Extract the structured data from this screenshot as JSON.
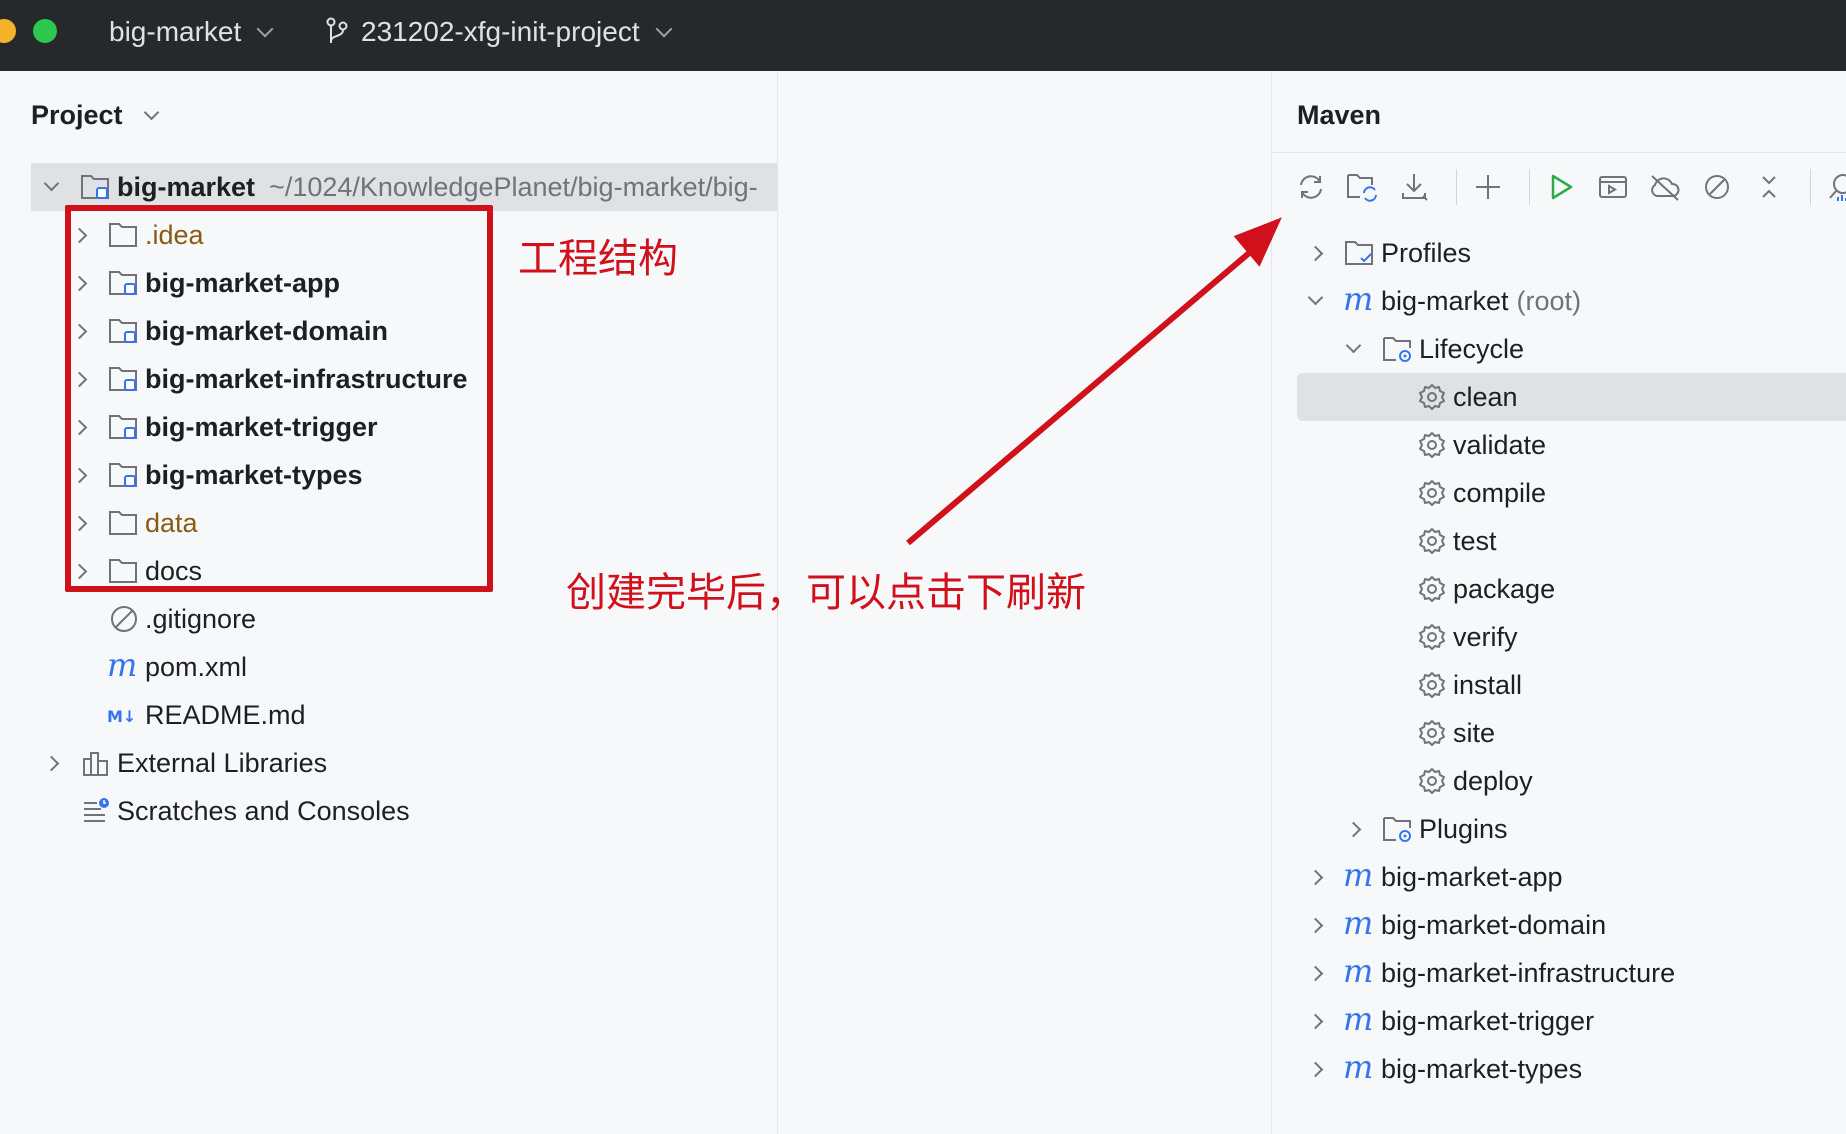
{
  "titlebar": {
    "project": "big-market",
    "branch": "231202-xfg-init-project"
  },
  "project_panel": {
    "title": "Project",
    "root": {
      "name": "big-market",
      "path": "~/1024/KnowledgePlanet/big-market/big-"
    },
    "items": [
      {
        "label": ".idea",
        "icon": "folder-icon",
        "style": "brown",
        "expandable": true
      },
      {
        "label": "big-market-app",
        "icon": "module-folder-icon",
        "style": "bold",
        "expandable": true
      },
      {
        "label": "big-market-domain",
        "icon": "module-folder-icon",
        "style": "bold",
        "expandable": true
      },
      {
        "label": "big-market-infrastructure",
        "icon": "module-folder-icon",
        "style": "bold",
        "expandable": true
      },
      {
        "label": "big-market-trigger",
        "icon": "module-folder-icon",
        "style": "bold",
        "expandable": true
      },
      {
        "label": "big-market-types",
        "icon": "module-folder-icon",
        "style": "bold",
        "expandable": true
      },
      {
        "label": "data",
        "icon": "folder-icon",
        "style": "brown",
        "expandable": true
      },
      {
        "label": "docs",
        "icon": "folder-icon",
        "style": "normal",
        "expandable": true
      },
      {
        "label": ".gitignore",
        "icon": "ignored-file-icon",
        "style": "normal",
        "expandable": false
      },
      {
        "label": "pom.xml",
        "icon": "maven-icon",
        "style": "normal",
        "expandable": false
      },
      {
        "label": "README.md",
        "icon": "markdown-icon",
        "style": "normal",
        "expandable": false
      }
    ],
    "external_libraries": "External Libraries",
    "scratches": "Scratches and Consoles"
  },
  "maven_panel": {
    "title": "Maven",
    "toolbar": [
      "reload-icon",
      "reload-project-icon",
      "download-icon",
      "add-icon",
      "run-icon",
      "execute-goal-icon",
      "offline-icon",
      "skip-tests-icon",
      "collapse-icon",
      "analyze-icon"
    ],
    "profiles": "Profiles",
    "root": {
      "name": "big-market",
      "suffix": "(root)"
    },
    "lifecycle": "Lifecycle",
    "goals": [
      "clean",
      "validate",
      "compile",
      "test",
      "package",
      "verify",
      "install",
      "site",
      "deploy"
    ],
    "selected_goal": "clean",
    "plugins": "Plugins",
    "modules": [
      "big-market-app",
      "big-market-domain",
      "big-market-infrastructure",
      "big-market-trigger",
      "big-market-types"
    ]
  },
  "annotations": {
    "structure_label": "工程结构",
    "refresh_hint": "创建完毕后，可以点击下刷新",
    "color": "#d0111c"
  }
}
